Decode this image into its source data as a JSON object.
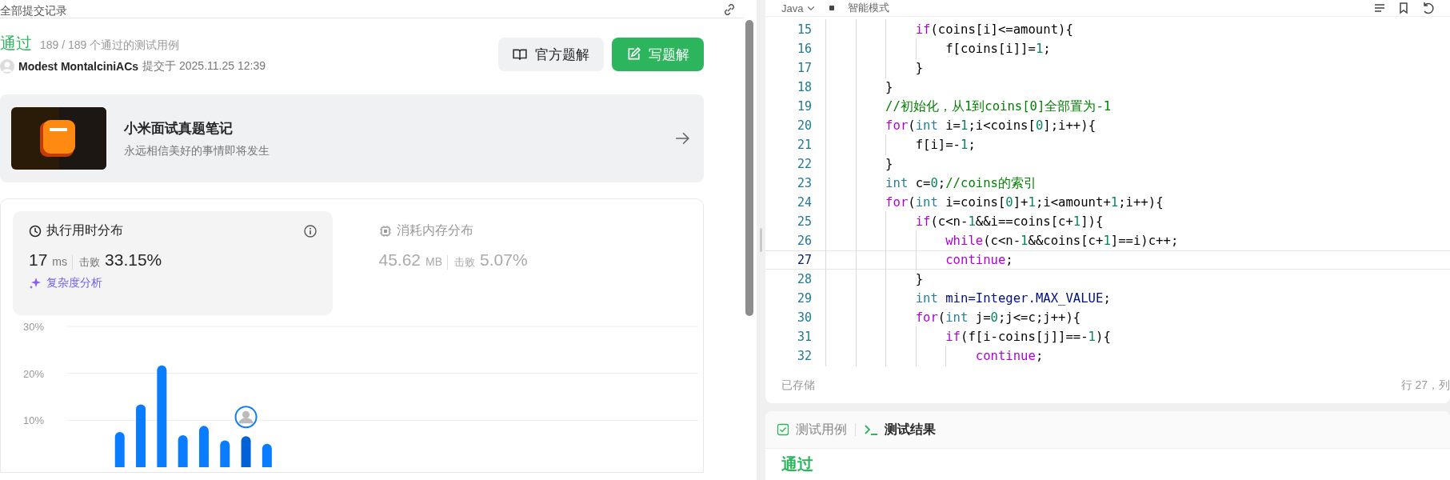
{
  "header": {
    "title": "全部提交记录"
  },
  "submission": {
    "status": "通过",
    "cases": "189 / 189 个通过的测试用例",
    "user": "Modest MontalciniACs",
    "submitted": "提交于 2025.11.25 12:39"
  },
  "buttons": [
    {
      "label": "官方题解",
      "kind": "secondary"
    },
    {
      "label": "写题解",
      "kind": "primary"
    }
  ],
  "promo": {
    "title": "小米面试真题笔记",
    "subtitle": "永远相信美好的事情即将发生"
  },
  "stats": [
    {
      "title": "执行用时分布",
      "value": "17",
      "unit": "ms",
      "beat_label": "击败",
      "beat": "33.15%",
      "selected": true
    },
    {
      "title": "消耗内存分布",
      "value": "45.62",
      "unit": "MB",
      "beat_label": "击败",
      "beat": "5.07%",
      "selected": false
    }
  ],
  "analysis_link": "复杂度分析",
  "chart_data": {
    "type": "bar",
    "ylim": [
      0,
      30
    ],
    "yticks": [
      {
        "value": 10,
        "label": "10%"
      },
      {
        "value": 20,
        "label": "20%"
      },
      {
        "value": 30,
        "label": "30%"
      }
    ],
    "stacked": true,
    "series": [
      {
        "color": "#0a7cff",
        "values": [
          null,
          null,
          7.5,
          13.4,
          21.7,
          6.8,
          8.8,
          5.7,
          null,
          5,
          null,
          null,
          null,
          null,
          null,
          null,
          null,
          null,
          null,
          null,
          null,
          null,
          null,
          null,
          null,
          null,
          null,
          null,
          null,
          null
        ]
      },
      {
        "color": "#0062d6",
        "values": [
          null,
          null,
          null,
          null,
          null,
          null,
          null,
          null,
          6.6,
          null,
          null,
          null,
          null,
          null,
          null,
          null,
          null,
          null,
          null,
          null,
          null,
          null,
          null,
          null,
          null,
          null,
          null,
          null,
          null,
          null
        ]
      }
    ]
  },
  "editor": {
    "language": "Java",
    "mode": "智能模式",
    "status": "已存储",
    "position": "行 27，列",
    "lines": [
      {
        "number": "15",
        "current": false,
        "tokens": [
          {
            "kind": "keyword",
            "text": "            if"
          },
          {
            "kind": "plain",
            "text": "(coins[i]<=amount){"
          }
        ]
      },
      {
        "number": "16",
        "current": false,
        "tokens": [
          {
            "kind": "plain",
            "text": "                f[coins[i]]="
          },
          {
            "kind": "number",
            "text": "1"
          },
          {
            "kind": "plain",
            "text": ";"
          }
        ]
      },
      {
        "number": "17",
        "current": false,
        "tokens": [
          {
            "kind": "plain",
            "text": "            }"
          }
        ]
      },
      {
        "number": "18",
        "current": false,
        "tokens": [
          {
            "kind": "plain",
            "text": "        }"
          }
        ]
      },
      {
        "number": "19",
        "current": false,
        "tokens": [
          {
            "kind": "comment",
            "text": "        //初始化，从1到coins[0]全部置为-1"
          }
        ]
      },
      {
        "number": "20",
        "current": false,
        "tokens": [
          {
            "kind": "keyword",
            "text": "        for"
          },
          {
            "kind": "plain",
            "text": "("
          },
          {
            "kind": "type",
            "text": "int"
          },
          {
            "kind": "plain",
            "text": " i="
          },
          {
            "kind": "number",
            "text": "1"
          },
          {
            "kind": "plain",
            "text": ";i<coins["
          },
          {
            "kind": "number",
            "text": "0"
          },
          {
            "kind": "plain",
            "text": "];i++){"
          }
        ]
      },
      {
        "number": "21",
        "current": false,
        "tokens": [
          {
            "kind": "plain",
            "text": "            f[i]=-"
          },
          {
            "kind": "number",
            "text": "1"
          },
          {
            "kind": "plain",
            "text": ";"
          }
        ]
      },
      {
        "number": "22",
        "current": false,
        "tokens": [
          {
            "kind": "plain",
            "text": "        }"
          }
        ]
      },
      {
        "number": "23",
        "current": false,
        "tokens": [
          {
            "kind": "type",
            "text": "        int"
          },
          {
            "kind": "plain",
            "text": " c="
          },
          {
            "kind": "number",
            "text": "0"
          },
          {
            "kind": "plain",
            "text": ";"
          },
          {
            "kind": "comment",
            "text": "//coins的索引"
          }
        ]
      },
      {
        "number": "24",
        "current": false,
        "tokens": [
          {
            "kind": "keyword",
            "text": "        for"
          },
          {
            "kind": "plain",
            "text": "("
          },
          {
            "kind": "type",
            "text": "int"
          },
          {
            "kind": "plain",
            "text": " i=coins["
          },
          {
            "kind": "number",
            "text": "0"
          },
          {
            "kind": "plain",
            "text": "]+"
          },
          {
            "kind": "number",
            "text": "1"
          },
          {
            "kind": "plain",
            "text": ";i<amount+"
          },
          {
            "kind": "number",
            "text": "1"
          },
          {
            "kind": "plain",
            "text": ";i++){"
          }
        ]
      },
      {
        "number": "25",
        "current": false,
        "tokens": [
          {
            "kind": "keyword",
            "text": "            if"
          },
          {
            "kind": "plain",
            "text": "(c<n-"
          },
          {
            "kind": "number",
            "text": "1"
          },
          {
            "kind": "plain",
            "text": "&&i==coins[c+"
          },
          {
            "kind": "number",
            "text": "1"
          },
          {
            "kind": "plain",
            "text": "]){"
          }
        ]
      },
      {
        "number": "26",
        "current": false,
        "tokens": [
          {
            "kind": "keyword",
            "text": "                while"
          },
          {
            "kind": "plain",
            "text": "(c<n-"
          },
          {
            "kind": "number",
            "text": "1"
          },
          {
            "kind": "plain",
            "text": "&&coins[c+"
          },
          {
            "kind": "number",
            "text": "1"
          },
          {
            "kind": "plain",
            "text": "]==i)c++;"
          }
        ]
      },
      {
        "number": "27",
        "current": true,
        "tokens": [
          {
            "kind": "keyword",
            "text": "                continue"
          },
          {
            "kind": "plain",
            "text": ";"
          }
        ]
      },
      {
        "number": "28",
        "current": false,
        "tokens": [
          {
            "kind": "plain",
            "text": "            }"
          }
        ]
      },
      {
        "number": "29",
        "current": false,
        "tokens": [
          {
            "kind": "type",
            "text": "            int"
          },
          {
            "kind": "constant",
            "text": " min=Integer.MAX_VALUE"
          },
          {
            "kind": "plain",
            "text": ";"
          }
        ]
      },
      {
        "number": "30",
        "current": false,
        "tokens": [
          {
            "kind": "keyword",
            "text": "            for"
          },
          {
            "kind": "plain",
            "text": "("
          },
          {
            "kind": "type",
            "text": "int"
          },
          {
            "kind": "plain",
            "text": " j="
          },
          {
            "kind": "number",
            "text": "0"
          },
          {
            "kind": "plain",
            "text": ";j<=c;j++){"
          }
        ]
      },
      {
        "number": "31",
        "current": false,
        "tokens": [
          {
            "kind": "keyword",
            "text": "                if"
          },
          {
            "kind": "plain",
            "text": "(f[i-coins[j]]==-"
          },
          {
            "kind": "number",
            "text": "1"
          },
          {
            "kind": "plain",
            "text": "){"
          }
        ]
      },
      {
        "number": "32",
        "current": false,
        "tokens": [
          {
            "kind": "keyword",
            "text": "                    continue"
          },
          {
            "kind": "plain",
            "text": ";"
          }
        ]
      }
    ]
  },
  "result_panel": {
    "tabs": [
      {
        "label": "测试用例",
        "kind": "cases",
        "selected": false
      },
      {
        "label": "测试结果",
        "kind": "result",
        "selected": true
      }
    ],
    "status": "通过"
  }
}
